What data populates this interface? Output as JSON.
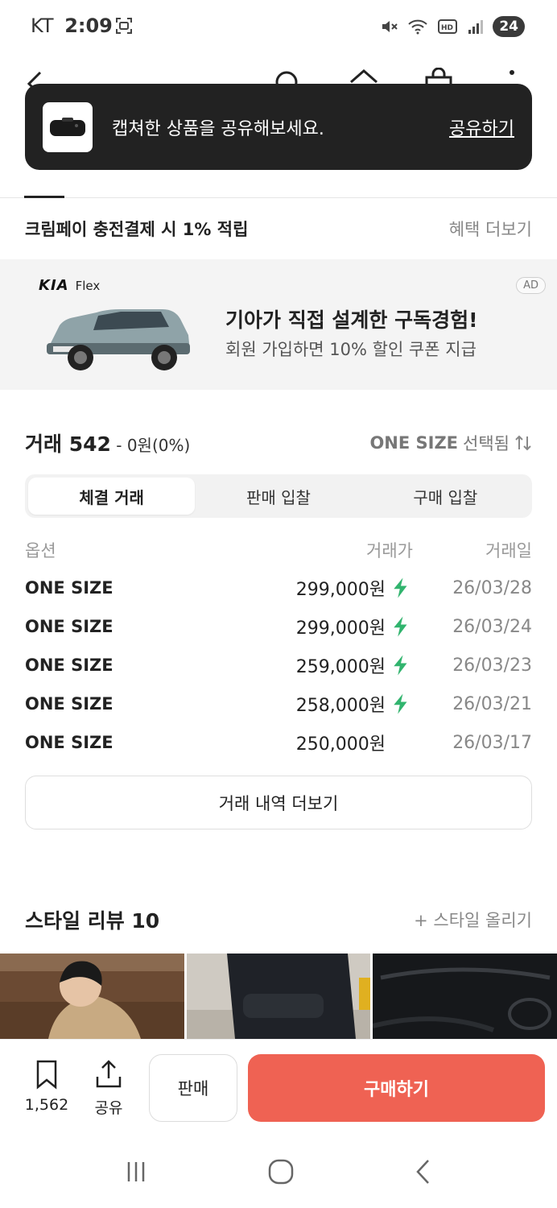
{
  "status_bar": {
    "carrier": "KT",
    "time": "2:09",
    "battery": "24"
  },
  "toast": {
    "message": "캡쳐한 상품을 공유해보세요.",
    "action": "공유하기"
  },
  "benefit": {
    "text": "크림페이 충전결제 시 1% 적립",
    "more": "혜택 더보기"
  },
  "ad": {
    "brand": "KIA",
    "sub_brand": "Flex",
    "headline": "기아가 직접 설계한 구독경험!",
    "subline": "회원 가입하면 10% 할인 쿠폰 지급",
    "badge": "AD"
  },
  "trade": {
    "title": "거래 542",
    "change": " - 0원(0%)",
    "size_selected": "ONE SIZE",
    "size_suffix": "선택됨",
    "tabs": [
      "체결 거래",
      "판매 입찰",
      "구매 입찰"
    ],
    "columns": [
      "옵션",
      "거래가",
      "거래일"
    ],
    "rows": [
      {
        "option": "ONE SIZE",
        "price": "299,000원",
        "date": "26/03/28",
        "fast": true
      },
      {
        "option": "ONE SIZE",
        "price": "299,000원",
        "date": "26/03/24",
        "fast": true
      },
      {
        "option": "ONE SIZE",
        "price": "259,000원",
        "date": "26/03/23",
        "fast": true
      },
      {
        "option": "ONE SIZE",
        "price": "258,000원",
        "date": "26/03/21",
        "fast": true
      },
      {
        "option": "ONE SIZE",
        "price": "250,000원",
        "date": "26/03/17",
        "fast": false
      }
    ],
    "more_button": "거래 내역 더보기"
  },
  "review": {
    "title": "스타일 리뷰 10",
    "upload": "+ 스타일 올리기"
  },
  "actions": {
    "bookmark_count": "1,562",
    "share_label": "공유",
    "sell_label": "판매",
    "buy_label": "구매하기"
  },
  "colors": {
    "buy": "#ef6253",
    "toast_bg": "#222222",
    "fast_bolt": "#31b46e"
  }
}
